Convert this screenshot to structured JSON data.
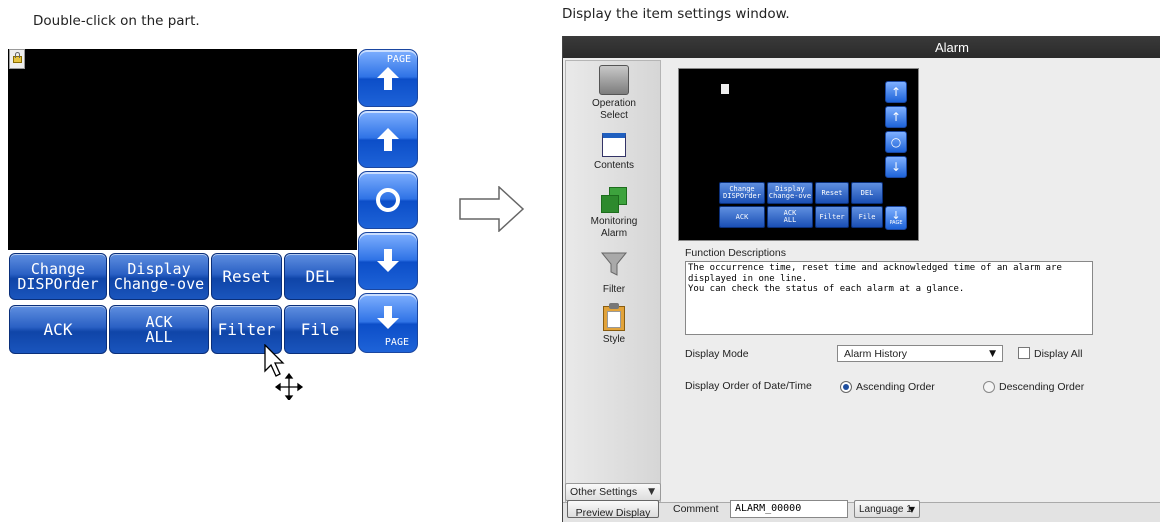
{
  "captions": {
    "left": "Double-click on the part.",
    "right": "Display the item settings window."
  },
  "left_panel": {
    "buttons": {
      "change": "Change\nDISPOrder",
      "display": "Display\nChange-ove",
      "reset": "Reset",
      "del": "DEL",
      "ack": "ACK",
      "ack_all": "ACK\nALL",
      "filter": "Filter",
      "file": "File"
    },
    "side_buttons": {
      "page_up_label": "PAGE",
      "page_down_label": "PAGE"
    }
  },
  "dialog": {
    "title": "Alarm",
    "sidebar": [
      {
        "label": "Operation\nSelect"
      },
      {
        "label": "Contents"
      },
      {
        "label": "Monitoring\nAlarm"
      },
      {
        "label": "Filter"
      },
      {
        "label": "Style"
      }
    ],
    "other_settings": "Other Settings",
    "preview": {
      "buttons": {
        "change": "Change\nDISPOrder",
        "display": "Display\nChange-ove",
        "reset": "Reset",
        "del": "DEL",
        "ack": "ACK",
        "ack_all": "ACK\nALL",
        "filter": "Filter",
        "file": "File"
      },
      "page_label": "PAGE"
    },
    "function_descriptions_label": "Function Descriptions",
    "function_descriptions_text": "The occurrence time, reset time and acknowledged time of an alarm are\ndisplayed in one line.\nYou can check the status of each alarm at a glance.",
    "display_mode_label": "Display Mode",
    "display_mode_value": "Alarm History",
    "display_all_label": "Display All",
    "display_all_checked": false,
    "display_order_label": "Display Order of Date/Time",
    "order_options": [
      "Ascending Order",
      "Descending Order"
    ],
    "order_selected": "Ascending Order",
    "bottom": {
      "preview_button": "Preview Display",
      "comment_label": "Comment",
      "comment_value": "ALARM_00000",
      "language_value": "Language 1"
    }
  }
}
